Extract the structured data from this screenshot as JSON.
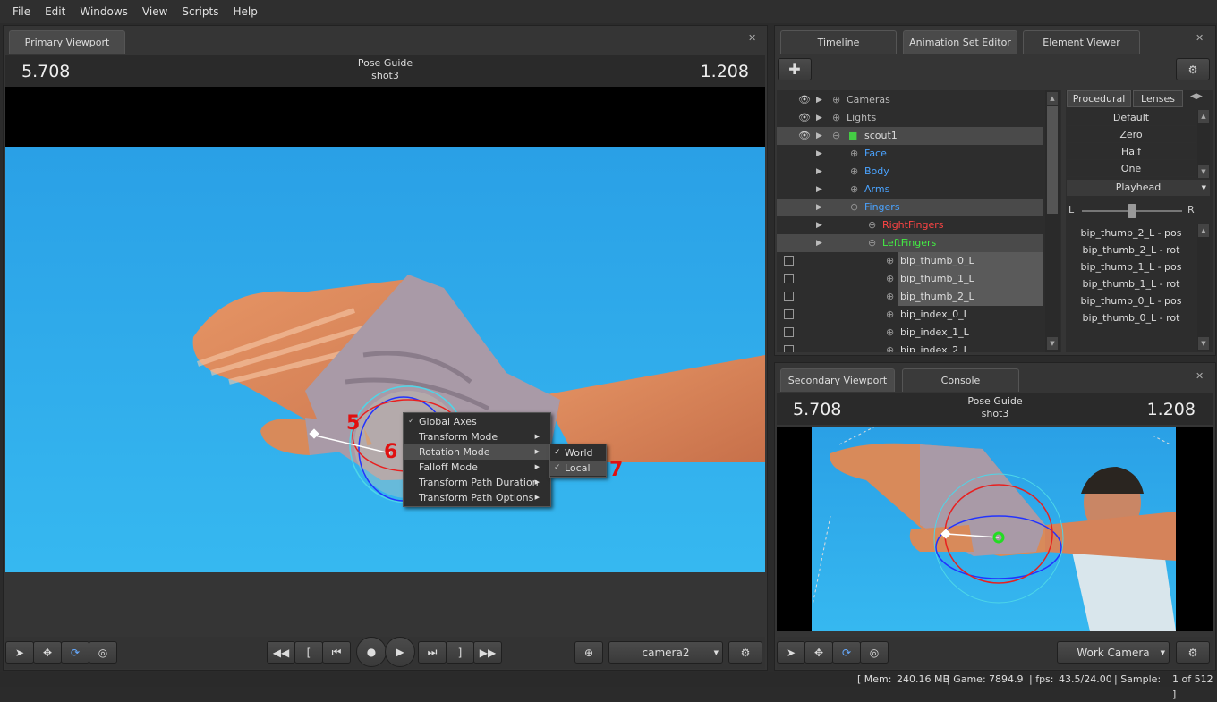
{
  "menu": [
    "File",
    "Edit",
    "Windows",
    "View",
    "Scripts",
    "Help"
  ],
  "primary": {
    "tab": "Primary Viewport",
    "left_num": "5.708",
    "right_num": "1.208",
    "guide": "Pose Guide",
    "shot": "shot3",
    "camera": "camera2"
  },
  "context_menu": {
    "items": [
      "Global Axes",
      "Transform Mode",
      "Rotation Mode",
      "Falloff Mode",
      "Transform Path Duration",
      "Transform Path Options"
    ],
    "submenu": [
      "World",
      "Local"
    ]
  },
  "annotations": [
    "5",
    "6",
    "7"
  ],
  "right_tabs": [
    "Timeline",
    "Animation Set Editor",
    "Element Viewer"
  ],
  "tree": [
    {
      "label": "Cameras",
      "color": "#bbbbbb"
    },
    {
      "label": "Lights",
      "color": "#bbbbbb"
    },
    {
      "label": "scout1",
      "color": "#dddddd"
    },
    {
      "label": "Face",
      "color": "#4aa3ff"
    },
    {
      "label": "Body",
      "color": "#4aa3ff"
    },
    {
      "label": "Arms",
      "color": "#4aa3ff"
    },
    {
      "label": "Fingers",
      "color": "#4aa3ff"
    },
    {
      "label": "RightFingers",
      "color": "#ff4444"
    },
    {
      "label": "LeftFingers",
      "color": "#44ee44"
    },
    {
      "label": "bip_thumb_0_L",
      "color": "#dddddd"
    },
    {
      "label": "bip_thumb_1_L",
      "color": "#dddddd"
    },
    {
      "label": "bip_thumb_2_L",
      "color": "#dddddd"
    },
    {
      "label": "bip_index_0_L",
      "color": "#dddddd"
    },
    {
      "label": "bip_index_1_L",
      "color": "#dddddd"
    },
    {
      "label": "bip_index_2_L",
      "color": "#dddddd"
    }
  ],
  "procedural": {
    "tabs": [
      "Procedural",
      "Lenses"
    ],
    "presets": [
      "Default",
      "Zero",
      "Half",
      "One"
    ],
    "playhead": "Playhead",
    "slider_left": "L",
    "slider_right": "R",
    "slider_value": 0.5,
    "controls": [
      "bip_thumb_2_L - pos",
      "bip_thumb_2_L - rot",
      "bip_thumb_1_L - pos",
      "bip_thumb_1_L - rot",
      "bip_thumb_0_L - pos",
      "bip_thumb_0_L - rot"
    ]
  },
  "secondary": {
    "tabs": [
      "Secondary Viewport",
      "Console"
    ],
    "left_num": "5.708",
    "right_num": "1.208",
    "guide": "Pose Guide",
    "shot": "shot3",
    "camera": "Work Camera"
  },
  "status": {
    "mem_label": "[ Mem:",
    "mem": "240.16 MB",
    "game_label": "| Game:",
    "game": "7894.9",
    "fps_label": "| fps:",
    "fps": "43.5/24.00",
    "sample_label": "| Sample:",
    "sample": "1 of 512 ]"
  }
}
